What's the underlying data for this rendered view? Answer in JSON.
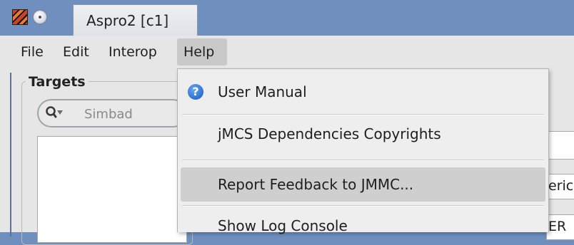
{
  "window": {
    "title": "Aspro2 [c1]"
  },
  "menubar": {
    "items": [
      "File",
      "Edit",
      "Interop",
      "Help"
    ]
  },
  "targets": {
    "title": "Targets",
    "search_placeholder": "Simbad"
  },
  "help_menu": {
    "items": [
      {
        "label": "User Manual",
        "icon": "help-icon"
      },
      {
        "label": "jMCS Dependencies Copyrights"
      },
      {
        "label": "Report Feedback to JMMC..."
      },
      {
        "label": "Show Log Console"
      }
    ]
  },
  "background_fields": {
    "field_2_text": "eric",
    "field_3_text": "ER"
  },
  "colors": {
    "title_bar": "#6f8fbf",
    "window_bg": "#e6e6e6",
    "menu_highlight": "#c9c9c9",
    "hovered_item": "#cfcfcf",
    "help_icon": "#2c6fd0"
  }
}
